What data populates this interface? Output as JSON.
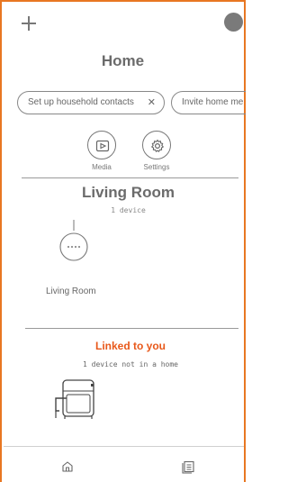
{
  "header": {
    "add_icon": "plus-icon",
    "avatar_icon": "user-avatar",
    "title": "Home"
  },
  "chips": [
    {
      "label": "Set up household contacts",
      "close_icon": "close-icon"
    },
    {
      "label": "Invite home me"
    }
  ],
  "quick_actions": [
    {
      "label": "Media",
      "icon": "play-icon"
    },
    {
      "label": "Settings",
      "icon": "gear-icon"
    }
  ],
  "room": {
    "title": "Living Room",
    "subtitle": "1 device",
    "devices": [
      {
        "label": "Living Room",
        "icon": "smart-speaker-icon"
      }
    ]
  },
  "linked": {
    "title": "Linked to you",
    "subtitle": "1 device not in a home",
    "devices": [
      {
        "icon": "air-fryer-icon"
      }
    ]
  },
  "bottom_nav": [
    {
      "icon": "home-icon"
    },
    {
      "icon": "list-icon"
    }
  ],
  "colors": {
    "accent": "#e8581a",
    "frame": "#e87722",
    "text": "#6b6b6b"
  }
}
